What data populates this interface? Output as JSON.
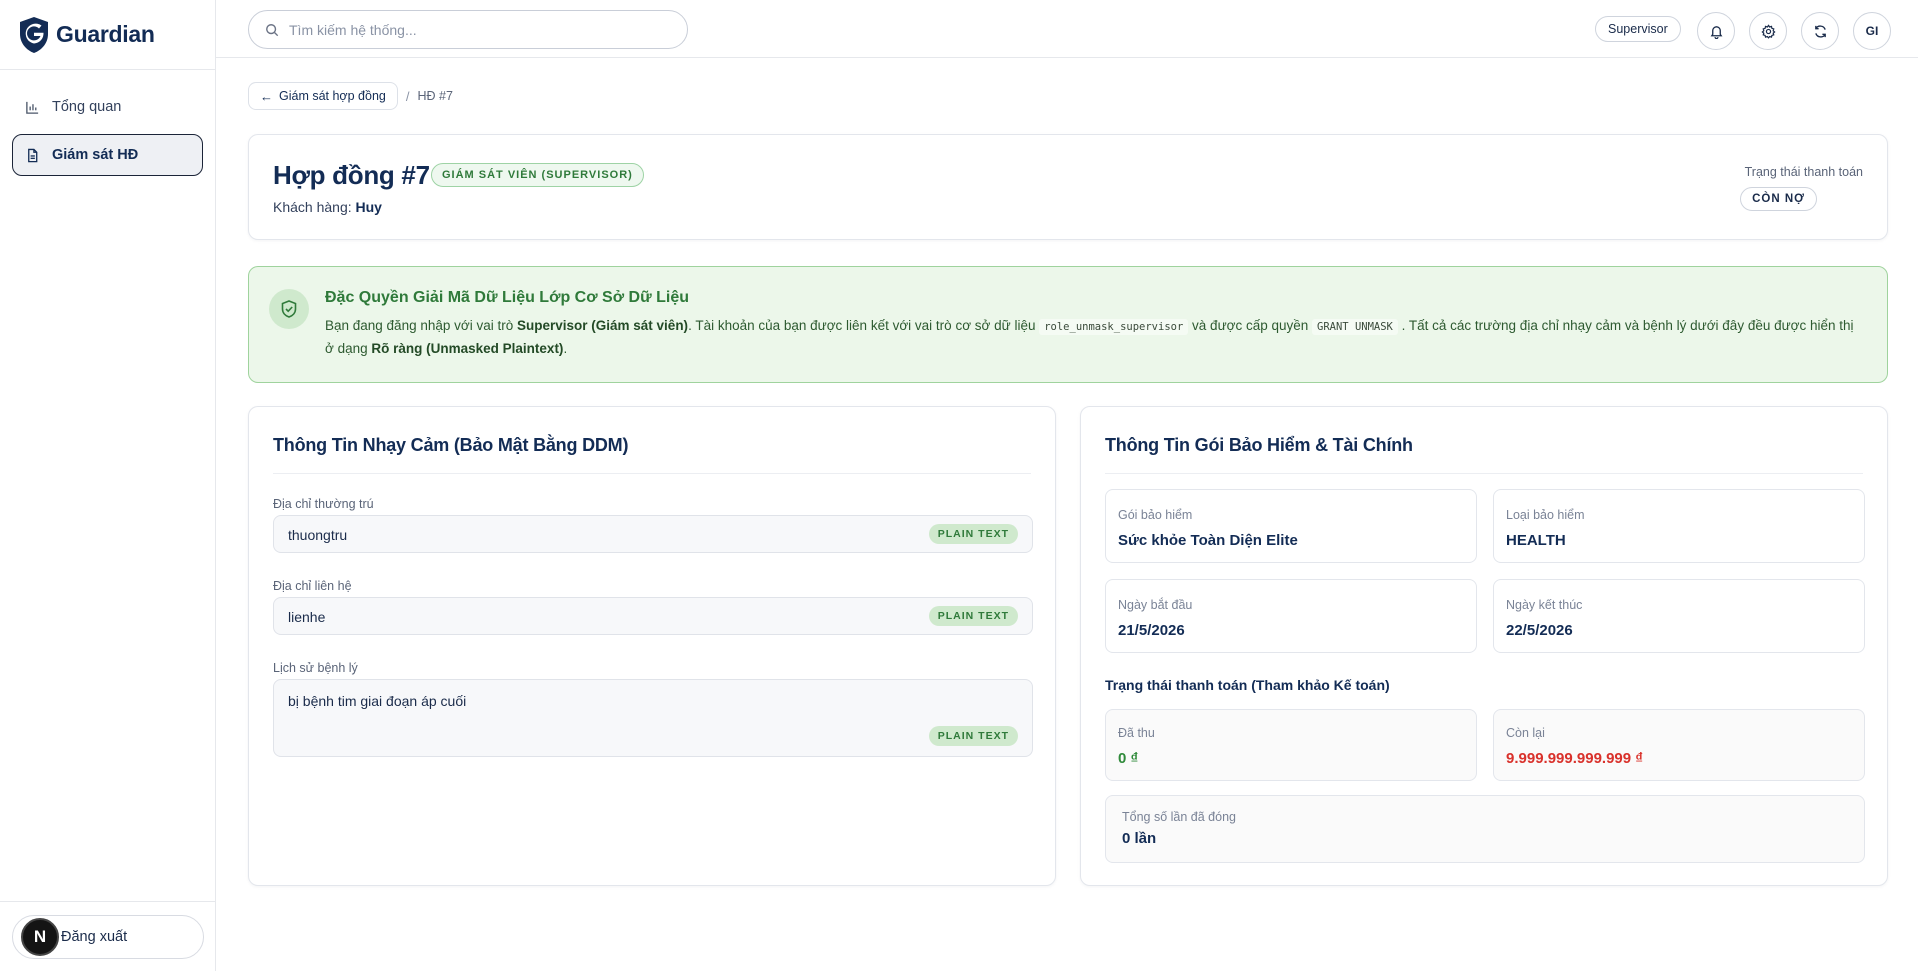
{
  "app": {
    "name": "Guardian"
  },
  "sidebar": {
    "items": [
      {
        "label": "Tổng quan"
      },
      {
        "label": "Giám sát HĐ"
      }
    ],
    "logout": {
      "avatar_letter": "N",
      "label": "Đăng xuất"
    }
  },
  "header": {
    "search_placeholder": "Tìm kiếm hệ thống...",
    "role": "Supervisor",
    "user_initials": "GI"
  },
  "breadcrumb": {
    "back": "Giám sát hợp đồng",
    "current": "HĐ #7"
  },
  "contract": {
    "title": "Hợp đồng #7",
    "role_badge": "GIÁM SÁT VIÊN (SUPERVISOR)",
    "customer_label": "Khách hàng:",
    "customer_name": "Huy",
    "payment_status_label": "Trạng thái thanh toán",
    "payment_status": "CÒN NỢ"
  },
  "notice": {
    "title": "Đặc Quyền Giải Mã Dữ Liệu Lớp Cơ Sở Dữ Liệu",
    "p1": "Bạn đang đăng nhập với vai trò ",
    "role_bold": "Supervisor (Giám sát viên)",
    "p2": ". Tài khoản của bạn được liên kết với vai trò cơ sở dữ liệu ",
    "db_role": "role_unmask_supervisor",
    "p3": " và được cấp quyền ",
    "grant": "GRANT UNMASK",
    "p4": " . Tất cả các trường địa chỉ nhạy cảm và bệnh lý dưới đây đều được hiển thị ở dạng ",
    "mode_bold": "Rõ ràng (Unmasked Plaintext)",
    "p5": "."
  },
  "sensitive": {
    "title": "Thông Tin Nhạy Cảm (Bảo Mật Bằng DDM)",
    "badge": "PLAIN TEXT",
    "fields": [
      {
        "label": "Địa chỉ thường trú",
        "value": "thuongtru"
      },
      {
        "label": "Địa chỉ liên hệ",
        "value": "lienhe"
      },
      {
        "label": "Lịch sử bệnh lý",
        "value": "bị bệnh tim giai đoạn áp cuối"
      }
    ]
  },
  "finance": {
    "title": "Thông Tin Gói Bảo Hiểm & Tài Chính",
    "plan_label": "Gói bảo hiểm",
    "plan_value": "Sức khỏe Toàn Diện Elite",
    "type_label": "Loại bảo hiểm",
    "type_value": "HEALTH",
    "start_label": "Ngày bắt đầu",
    "start_value": "21/5/2026",
    "end_label": "Ngày kết thúc",
    "end_value": "22/5/2026",
    "payment_heading": "Trạng thái thanh toán (Tham khảo Kế toán)",
    "paid_label": "Đã thu",
    "paid_value": "0 ₫",
    "remaining_label": "Còn lại",
    "remaining_value": "9.999.999.999.999 ₫",
    "count_label": "Tổng số lần đã đóng",
    "count_value": "0 lần"
  },
  "colors": {
    "brand": "#132c55",
    "success": "#2f7a3a",
    "danger": "#d9312b",
    "notice_bg": "#ecf7ea"
  }
}
